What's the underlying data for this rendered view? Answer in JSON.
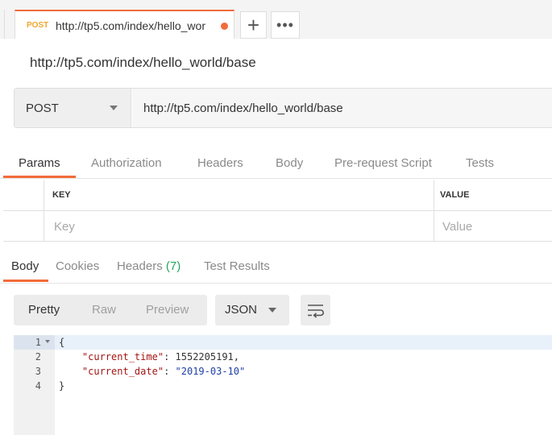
{
  "request_tab": {
    "method": "POST",
    "url": "http://tp5.com/index/hello_wor"
  },
  "tab_actions": {
    "new_tab": "+",
    "more": "•••"
  },
  "request_name": "http://tp5.com/index/hello_world/base",
  "url_bar": {
    "method": "POST",
    "url": "http://tp5.com/index/hello_world/base"
  },
  "request_tabs": [
    "Params",
    "Authorization",
    "Headers",
    "Body",
    "Pre-request Script",
    "Tests"
  ],
  "params_table": {
    "headers": [
      "KEY",
      "VALUE"
    ],
    "placeholders": [
      "Key",
      "Value"
    ]
  },
  "response_tabs": {
    "body": "Body",
    "cookies": "Cookies",
    "headers": "Headers",
    "headers_count": "(7)",
    "test_results": "Test Results"
  },
  "response_toolbar": {
    "views": [
      "Pretty",
      "Raw",
      "Preview"
    ],
    "format": "JSON"
  },
  "response_body": {
    "line_numbers": [
      "1",
      "2",
      "3",
      "4"
    ],
    "open_brace": "{",
    "close_brace": "}",
    "fields": [
      {
        "key": "\"current_time\"",
        "value": "1552205191",
        "sep": ",",
        "value_type": "number"
      },
      {
        "key": "\"current_date\"",
        "value": "\"2019-03-10\"",
        "sep": "",
        "value_type": "string"
      }
    ]
  },
  "colors": {
    "accent": "#f26b3a",
    "method_label": "#f2a62c",
    "count_green": "#26a660",
    "json_key": "#a31515",
    "json_string": "#1e3ea8"
  }
}
